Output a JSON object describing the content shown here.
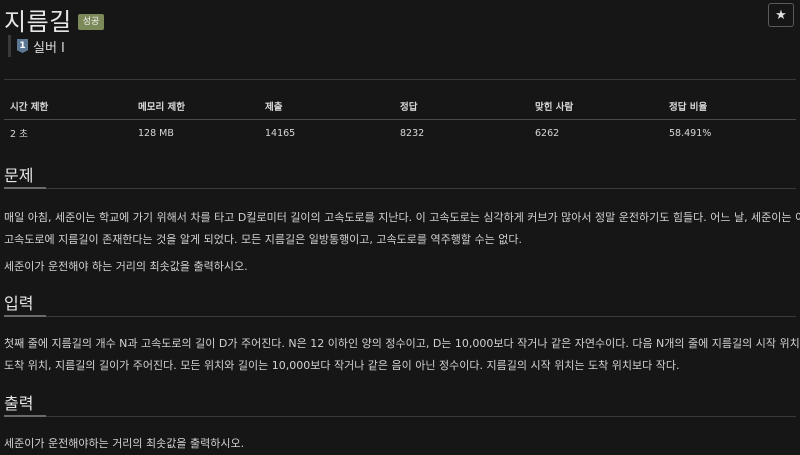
{
  "header": {
    "title": "지름길",
    "badge": "성공",
    "star_icon": "★"
  },
  "tier": {
    "icon_number": "1",
    "label": "실버 I"
  },
  "stats": {
    "headers": [
      "시간 제한",
      "메모리 제한",
      "제출",
      "정답",
      "맞힌 사람",
      "정답 비율"
    ],
    "values": [
      "2 초",
      "128 MB",
      "14165",
      "8232",
      "6262",
      "58.491%"
    ]
  },
  "problem": {
    "heading": "문제",
    "lines": [
      "매일 아침, 세준이는 학교에 가기 위해서 차를 타고 D킬로미터 길이의 고속도로를 지난다. 이 고속도로는 심각하게 커브가 많아서 정말 운전하기도 힘들다. 어느 날, 세준이는 이",
      "고속도로에 지름길이 존재한다는 것을 알게 되었다. 모든 지름길은 일방통행이고, 고속도로를 역주행할 수는 없다.",
      "세준이가 운전해야 하는 거리의 최솟값을 출력하시오."
    ]
  },
  "input": {
    "heading": "입력",
    "lines": [
      "첫째 줄에 지름길의 개수 N과 고속도로의 길이 D가 주어진다. N은 12 이하인 양의 정수이고, D는 10,000보다 작거나 같은 자연수이다. 다음 N개의 줄에 지름길의 시작 위치,",
      "도착 위치, 지름길의 길이가 주어진다. 모든 위치와 길이는 10,000보다 작거나 같은 음이 아닌 정수이다. 지름길의 시작 위치는 도착 위치보다 작다."
    ]
  },
  "output": {
    "heading": "출력",
    "lines": [
      "세준이가 운전해야하는 거리의 최솟값을 출력하시오."
    ]
  }
}
